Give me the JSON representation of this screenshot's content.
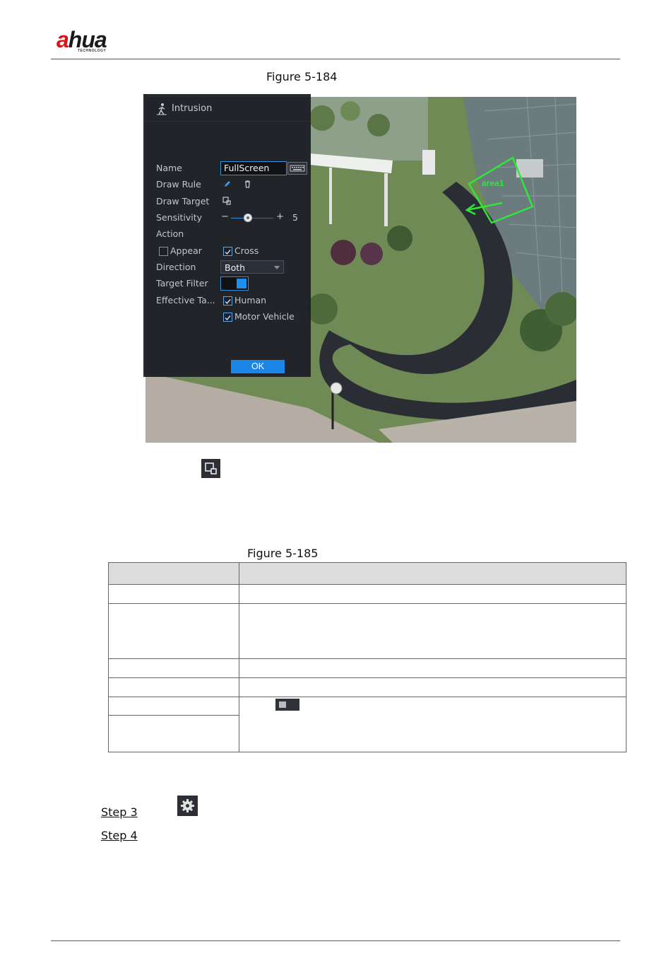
{
  "header": {
    "logo_main_left": "a",
    "logo_main_right": "hua",
    "logo_sub": "TECHNOLOGY"
  },
  "figures": {
    "fig1_caption": "Figure 5-184",
    "fig2_caption": "Figure 5-185"
  },
  "panel": {
    "title": "Intrusion",
    "name_label": "Name",
    "name_value": "FullScreen",
    "draw_rule_label": "Draw Rule",
    "draw_target_label": "Draw Target",
    "sensitivity_label": "Sensitivity",
    "sensitivity_minus": "−",
    "sensitivity_plus": "+",
    "sensitivity_value": "5",
    "sensitivity_level": 0.4,
    "action_label": "Action",
    "appear_label": "Appear",
    "appear_checked": false,
    "cross_label": "Cross",
    "cross_checked": true,
    "direction_label": "Direction",
    "direction_value": "Both",
    "target_filter_label": "Target Filter",
    "target_filter_on": true,
    "effective_target_label": "Effective Ta...",
    "human_label": "Human",
    "human_checked": true,
    "motor_vehicle_label": "Motor Vehicle",
    "motor_vehicle_checked": true,
    "ok_label": "OK"
  },
  "scene": {
    "area_label": "area1"
  },
  "steps": {
    "step3": "Step 3",
    "step4": "Step 4"
  },
  "colors": {
    "accent": "#1c86e6",
    "brand_red": "#d7141a",
    "rule_green": "#2fe63a"
  }
}
